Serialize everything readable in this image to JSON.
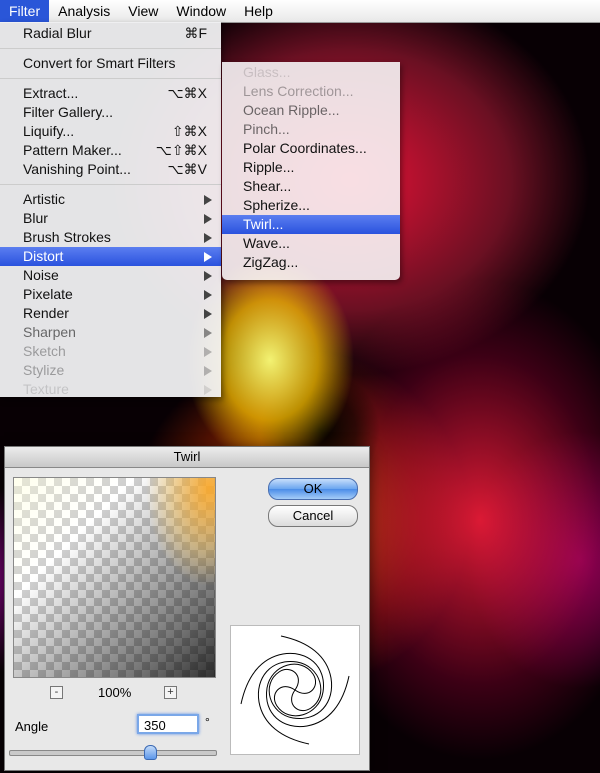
{
  "menubar": {
    "items": [
      {
        "label": "Filter",
        "active": true
      },
      {
        "label": "Analysis"
      },
      {
        "label": "View"
      },
      {
        "label": "Window"
      },
      {
        "label": "Help"
      }
    ]
  },
  "filter_menu": {
    "last_filter": {
      "label": "Radial Blur",
      "shortcut": "⌘F"
    },
    "smart": "Convert for Smart Filters",
    "tools": [
      {
        "label": "Extract...",
        "shortcut": "⌥⌘X"
      },
      {
        "label": "Filter Gallery...",
        "shortcut": ""
      },
      {
        "label": "Liquify...",
        "shortcut": "⇧⌘X"
      },
      {
        "label": "Pattern Maker...",
        "shortcut": "⌥⇧⌘X"
      },
      {
        "label": "Vanishing Point...",
        "shortcut": "⌥⌘V"
      }
    ],
    "groups": [
      "Artistic",
      "Blur",
      "Brush Strokes",
      "Distort",
      "Noise",
      "Pixelate",
      "Render",
      "Sharpen",
      "Sketch",
      "Stylize",
      "Texture"
    ],
    "highlighted": "Distort"
  },
  "distort_submenu": {
    "items": [
      "Glass...",
      "Lens Correction...",
      "Ocean Ripple...",
      "Pinch...",
      "Polar Coordinates...",
      "Ripple...",
      "Shear...",
      "Spherize...",
      "Twirl...",
      "Wave...",
      "ZigZag..."
    ],
    "highlighted": "Twirl..."
  },
  "twirl_dialog": {
    "title": "Twirl",
    "ok_label": "OK",
    "cancel_label": "Cancel",
    "zoom_out": "-",
    "zoom_in": "+",
    "zoom_level": "100%",
    "angle_label": "Angle",
    "angle_value": "350",
    "angle_unit": "°",
    "slider_fraction": 0.68
  },
  "colors": {
    "menu_highlight": "#2a52de",
    "default_button": "#4b8de8"
  }
}
